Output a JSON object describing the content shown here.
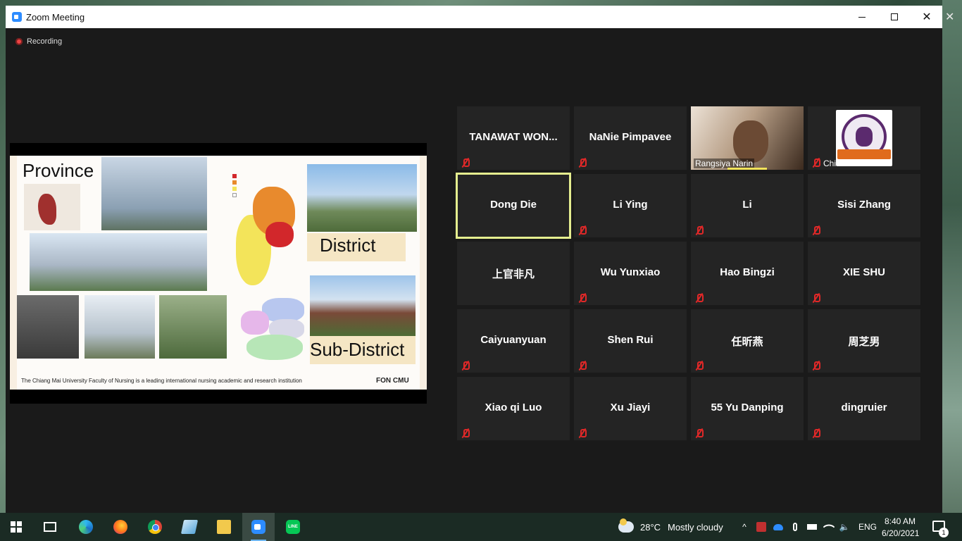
{
  "window": {
    "title": "Zoom Meeting",
    "close_glyph": "✕"
  },
  "desktop": {
    "close_glyph": "✕"
  },
  "recording": {
    "label": "Recording"
  },
  "slide": {
    "province": "Province",
    "district": "District",
    "sub_district": "Sub-District",
    "caption": "The Chiang Mai University Faculty of Nursing is a leading international nursing academic and research institution",
    "brand": "FON CMU",
    "legend_colors": [
      "#d2272b",
      "#e88a2d",
      "#f3e45a",
      "#ffffff"
    ]
  },
  "participants": [
    {
      "name": "TANAWAT WON...",
      "muted": true
    },
    {
      "name": "NaNie Pimpavee",
      "muted": true
    },
    {
      "name": "Rangsiya Narin",
      "muted": false,
      "video": true
    },
    {
      "name": "Chiara",
      "muted": true,
      "logo": true
    },
    {
      "name": "Dong Die",
      "muted": false,
      "active_speaker": true
    },
    {
      "name": "Li Ying",
      "muted": true
    },
    {
      "name": "Li",
      "muted": true
    },
    {
      "name": "Sisi Zhang",
      "muted": true
    },
    {
      "name": "上官非凡",
      "muted": false
    },
    {
      "name": "Wu Yunxiao",
      "muted": true
    },
    {
      "name": "Hao Bingzi",
      "muted": true
    },
    {
      "name": "XIE SHU",
      "muted": true
    },
    {
      "name": "Caiyuanyuan",
      "muted": true
    },
    {
      "name": "Shen Rui",
      "muted": true
    },
    {
      "name": "任昕燕",
      "muted": true
    },
    {
      "name": "周芝男",
      "muted": true
    },
    {
      "name": "Xiao qi Luo",
      "muted": true
    },
    {
      "name": "Xu Jiayi",
      "muted": true
    },
    {
      "name": "55 Yu Danping",
      "muted": true
    },
    {
      "name": "dingruier",
      "muted": true
    }
  ],
  "taskbar": {
    "weather_temp": "28°C",
    "weather_desc": "Mostly cloudy",
    "language": "ENG",
    "time": "8:40 AM",
    "date": "6/20/2021",
    "notification_count": "1",
    "line_label": "LINE",
    "tray_glyphs": {
      "chevron": "^",
      "volume": "🔈"
    }
  },
  "colors": {
    "active_speaker": "#e5ee8f",
    "muted": "#e02828",
    "zoom_blue": "#2d8cff"
  }
}
